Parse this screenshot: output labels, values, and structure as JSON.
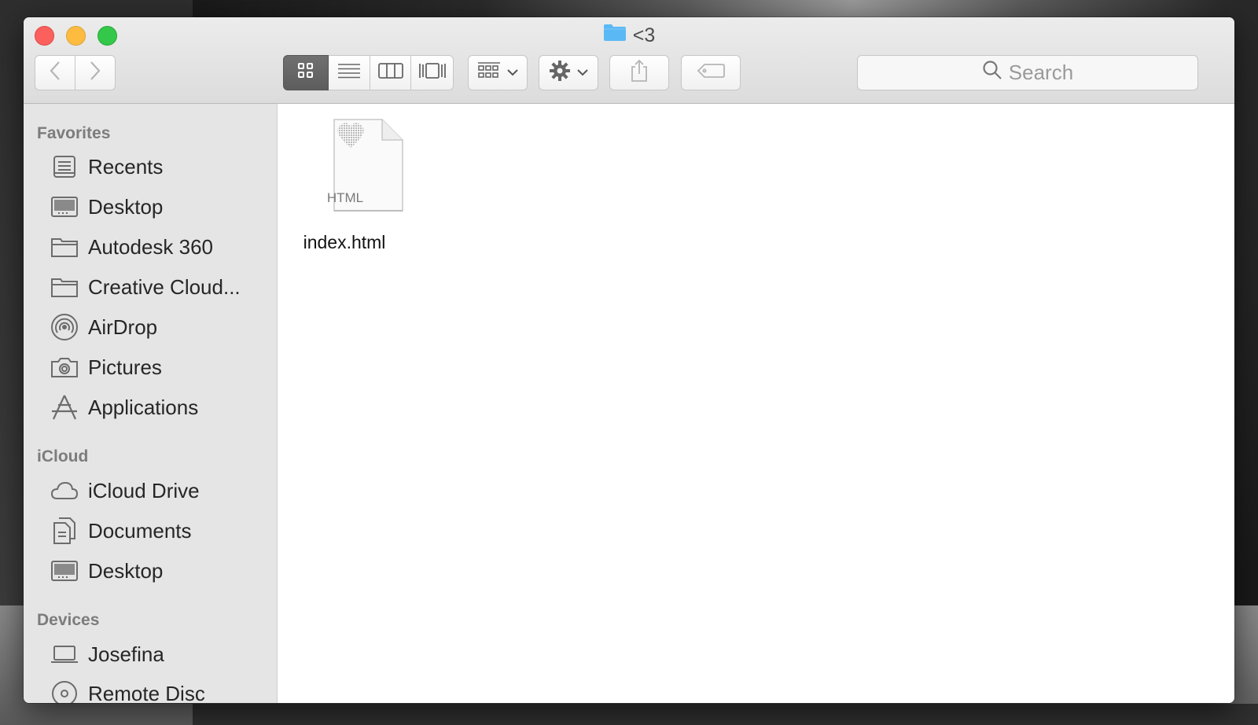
{
  "window": {
    "title": "<3"
  },
  "toolbar": {
    "back_icon": "chevron-left-icon",
    "forward_icon": "chevron-right-icon",
    "view_modes": [
      "icon-view-icon",
      "list-view-icon",
      "column-view-icon",
      "cover-flow-icon"
    ],
    "group_icon": "group-by-icon",
    "action_icon": "gear-icon",
    "share_icon": "share-icon",
    "tag_icon": "tag-icon",
    "search_placeholder": "Search"
  },
  "sidebar": {
    "favorites_header": "Favorites",
    "favorites": [
      {
        "label": "Recents",
        "icon": "recents-icon"
      },
      {
        "label": "Desktop",
        "icon": "desktop-icon"
      },
      {
        "label": "Autodesk 360",
        "icon": "folder-icon"
      },
      {
        "label": "Creative Cloud...",
        "icon": "folder-icon"
      },
      {
        "label": "AirDrop",
        "icon": "airdrop-icon"
      },
      {
        "label": "Pictures",
        "icon": "camera-icon"
      },
      {
        "label": "Applications",
        "icon": "applications-icon"
      }
    ],
    "icloud_header": "iCloud",
    "icloud": [
      {
        "label": "iCloud Drive",
        "icon": "cloud-icon"
      },
      {
        "label": "Documents",
        "icon": "documents-icon"
      },
      {
        "label": "Desktop",
        "icon": "desktop-icon"
      }
    ],
    "devices_header": "Devices",
    "devices": [
      {
        "label": "Josefina",
        "icon": "laptop-icon"
      },
      {
        "label": "Remote Disc",
        "icon": "disc-icon"
      }
    ]
  },
  "files": [
    {
      "name": "index.html",
      "type_label": "HTML",
      "icon": "html-file-icon"
    }
  ],
  "colors": {
    "close": "#fc605c",
    "minimize": "#fdbc40",
    "maximize": "#34c84a",
    "folder": "#5ab8f5"
  }
}
